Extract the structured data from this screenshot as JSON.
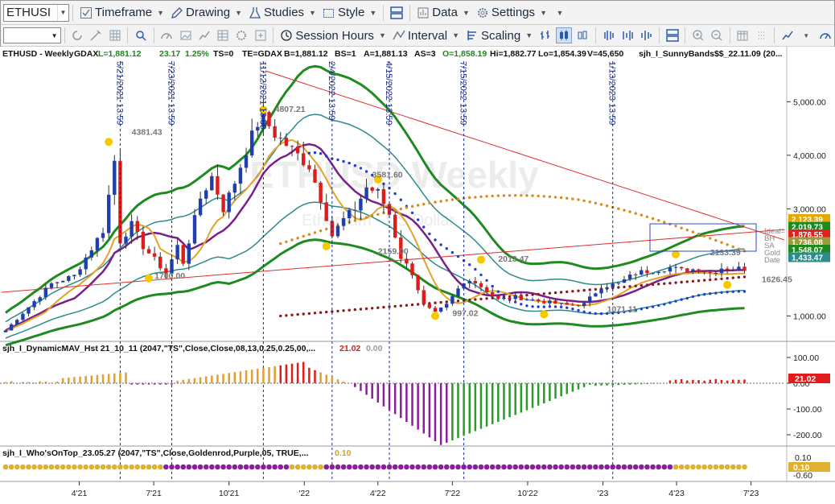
{
  "symbol": "ETHUSI",
  "toolbar1": {
    "timeframe": "Timeframe",
    "drawing": "Drawing",
    "studies": "Studies",
    "style": "Style",
    "data": "Data",
    "settings": "Settings"
  },
  "toolbar2": {
    "session_hours": "Session Hours",
    "interval": "Interval",
    "scaling": "Scaling"
  },
  "header": {
    "sym": "ETHUSD - Weekly",
    "exch": "GDAX",
    "last": "L=1,881.12",
    "chg": "23.17",
    "pct": "1.25%",
    "ts": "TS=0",
    "te": "TE=GDAX",
    "b": "B=1,881.12",
    "bs": "BS=1",
    "a": "A=1,881.13",
    "as": "AS=3",
    "o": "O=1,858.19",
    "hi": "Hi=1,882.77",
    "lo": "Lo=1,854.39",
    "v": "V=45,650",
    "study": "sjh_I_SunnyBands$$_22.11.09 (20..."
  },
  "watermark": {
    "title": "ETHUSD Weekly",
    "subtitle": "Ethereum - US Dollar"
  },
  "price_axis": {
    "ticks": [
      {
        "label": "5,000.00",
        "value": 5000
      },
      {
        "label": "4,000.00",
        "value": 4000
      },
      {
        "label": "3,000.00",
        "value": 3000
      },
      {
        "label": "1,000.00",
        "value": 1000
      }
    ],
    "tags": [
      {
        "label": "2,123.39",
        "value": 2123.39,
        "color": "#e5a800"
      },
      {
        "label": "2,019.73",
        "value": 2019.73,
        "color": "#1e8a1e"
      },
      {
        "label": "1,876.55",
        "value": 1876.55,
        "color": "#e51f1f"
      },
      {
        "label": "1,736.08",
        "value": 1736.08,
        "color": "#9b9b3a"
      },
      {
        "label": "1,548.07",
        "value": 1548.07,
        "color": "#1e8a1e"
      },
      {
        "label": "1,433.47",
        "value": 1433.47,
        "color": "#2e8b8b"
      }
    ],
    "side_labels": [
      "Ideal=",
      "BH",
      "SA",
      "Gold",
      "Date"
    ]
  },
  "vlines": [
    {
      "label": "5/21/2021 13:59",
      "date": "2021-05-21"
    },
    {
      "label": "7/23/2021 13:59",
      "date": "2021-07-23"
    },
    {
      "label": "11/12/2021 13:59",
      "date": "2021-11-12"
    },
    {
      "label": "2/4/2022 13:59",
      "date": "2022-02-04"
    },
    {
      "label": "4/15/2022 13:59",
      "date": "2022-04-15"
    },
    {
      "label": "7/15/2022 13:59",
      "date": "2022-07-15"
    },
    {
      "label": "1/13/2023 13:59",
      "date": "2023-01-13"
    }
  ],
  "annotations": [
    {
      "label": "4381.43",
      "date": "2021-06-04",
      "price": 4381
    },
    {
      "label": "1700.00",
      "date": "2021-07-02",
      "price": 1700
    },
    {
      "label": "4807.21",
      "date": "2021-11-26",
      "price": 4807
    },
    {
      "label": "3581.60",
      "date": "2022-03-25",
      "price": 3581
    },
    {
      "label": "2159.00",
      "date": "2022-04-01",
      "price": 2159
    },
    {
      "label": "2013.47",
      "date": "2022-08-26",
      "price": 2013
    },
    {
      "label": "997.02",
      "date": "2022-07-01",
      "price": 997
    },
    {
      "label": "1071.11",
      "date": "2023-01-06",
      "price": 1071
    },
    {
      "label": "2133.39",
      "date": "2023-05-12",
      "price": 2133
    },
    {
      "label": "1626.45",
      "date": "2023-07-14",
      "price": 1626
    }
  ],
  "date_axis": {
    "ticks": [
      {
        "label": "4'21",
        "date": "2021-04-01"
      },
      {
        "label": "7'21",
        "date": "2021-07-01"
      },
      {
        "label": "10'21",
        "date": "2021-10-01"
      },
      {
        "label": "'22",
        "date": "2022-01-01"
      },
      {
        "label": "4'22",
        "date": "2022-04-01"
      },
      {
        "label": "7'22",
        "date": "2022-07-01"
      },
      {
        "label": "10'22",
        "date": "2022-10-01"
      },
      {
        "label": "'23",
        "date": "2023-01-01"
      },
      {
        "label": "4'23",
        "date": "2023-04-01"
      },
      {
        "label": "7'23",
        "date": "2023-07-01"
      }
    ]
  },
  "indicator1": {
    "title": "sjh_I_DynamicMAV_Hst 21_10_11 (2047,\"TS\",Close,Close,08,13,0.25,0.25,00,...",
    "v1": "21.02",
    "v2": "0.00",
    "ticks": [
      {
        "label": "100.00",
        "value": 100
      },
      {
        "label": "0.00",
        "value": 0
      },
      {
        "label": "-100.00",
        "value": -100
      },
      {
        "label": "-200.00",
        "value": -200
      }
    ],
    "tag": "21.02"
  },
  "indicator2": {
    "title": "sjh_I_Who'sOnTop_23.05.27 (2047,\"TS\",Close,Goldenrod,Purple,05,  TRUE,...",
    "v1": "0.10",
    "tick_high": "0.10",
    "tick_low": "-0.60",
    "tag": "0.10"
  },
  "colors": {
    "up_candle": "#1f3fb0",
    "down_candle": "#e01b1b",
    "outer_band": "#1f8a1f",
    "mid_band": "#2e8b8b",
    "purple": "#7a1f8a",
    "gold": "#e5a22a",
    "blue_dots": "#1f3fd8",
    "orange_dots": "#d98a1a",
    "maroon_dots": "#8b1a1a",
    "swing": "#f5c800",
    "hist_up": "#e0a030",
    "hist_down_red": "#e01b1b",
    "hist_purple": "#8a1f9a",
    "hist_green": "#2a9a2a",
    "vline": "#1a2a8a"
  }
}
